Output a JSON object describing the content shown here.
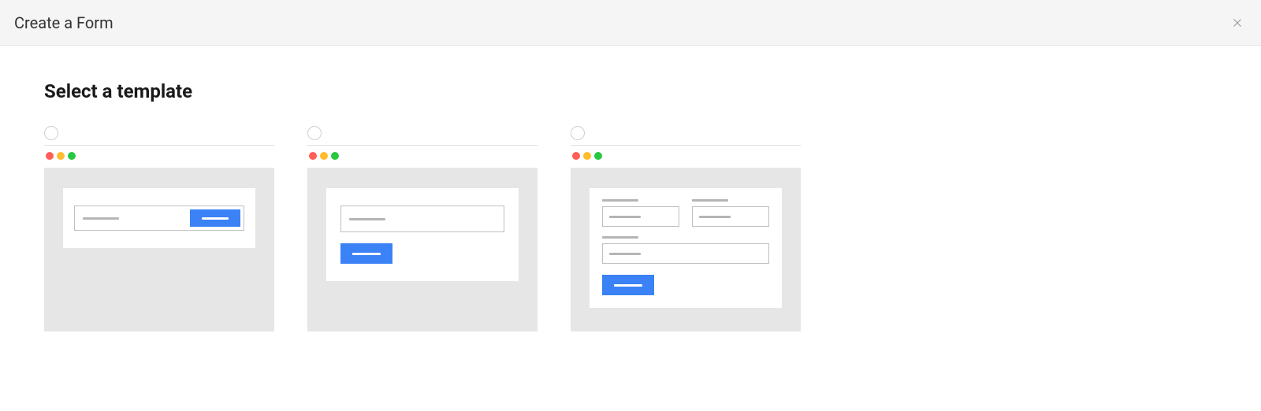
{
  "header": {
    "title": "Create a Form"
  },
  "section": {
    "title": "Select a template"
  },
  "templates": [
    {
      "id": "inline",
      "selected": false
    },
    {
      "id": "stacked",
      "selected": false
    },
    {
      "id": "multi-field",
      "selected": false
    }
  ],
  "colors": {
    "accent": "#3b82f6",
    "traffic_red": "#ff5f57",
    "traffic_yellow": "#febc2e",
    "traffic_green": "#28c840"
  }
}
